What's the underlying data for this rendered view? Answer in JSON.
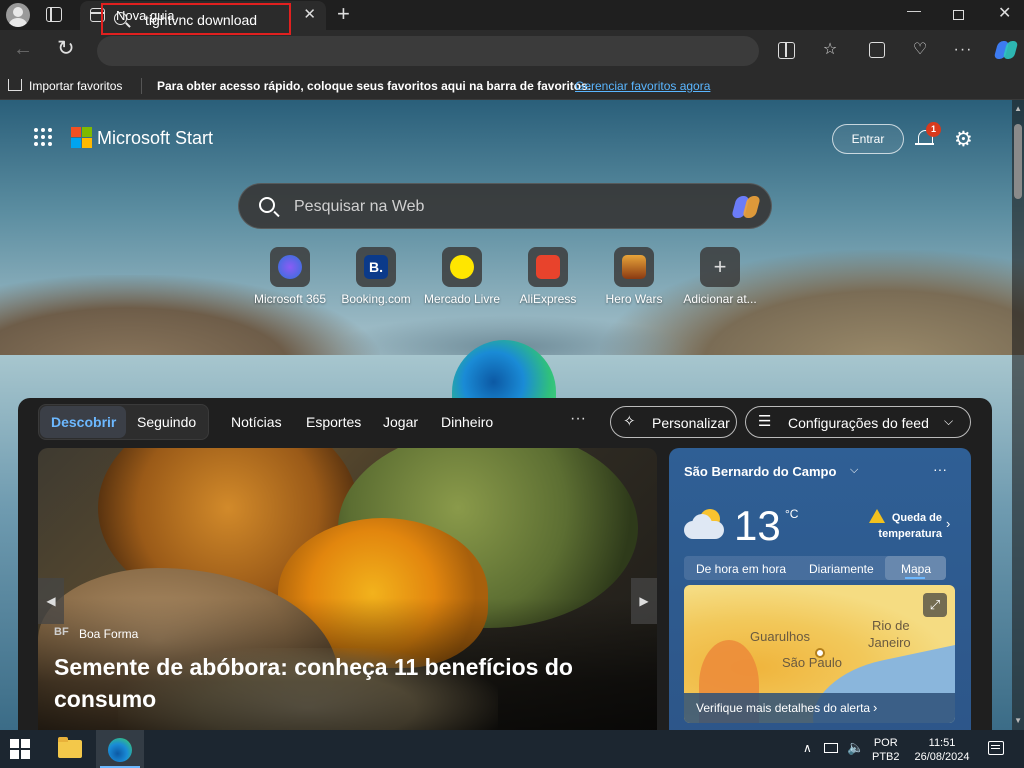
{
  "browser": {
    "tab_title": "Nova guia",
    "address_value": "tightvnc download",
    "icons": [
      "profile-icon",
      "tab-actions-icon",
      "back-icon",
      "refresh-icon",
      "split-screen-icon",
      "favorites-icon",
      "collections-icon",
      "browser-essentials-icon",
      "more-icon",
      "copilot-icon"
    ],
    "highlight_color": "#e0201f"
  },
  "favorites_bar": {
    "import_label": "Importar favoritos",
    "message": "Para obter acesso rápido, coloque seus favoritos aqui na barra de favoritos.",
    "manage_link": "Gerenciar favoritos agora"
  },
  "start_page": {
    "brand": "Microsoft Start",
    "signin_label": "Entrar",
    "notification_count": "1",
    "search_placeholder": "Pesquisar na Web",
    "quick_links": [
      {
        "label": "Microsoft 365",
        "glyph": "",
        "color": "#5a63d8"
      },
      {
        "label": "Booking.com",
        "glyph": "B.",
        "color": "#0b3a8a"
      },
      {
        "label": "Mercado Livre",
        "glyph": "",
        "color": "#ffe600"
      },
      {
        "label": "AliExpress",
        "glyph": "",
        "color": "#e8432c"
      },
      {
        "label": "Hero Wars",
        "glyph": "",
        "color": "#c26b1e"
      },
      {
        "label": "Adicionar at...",
        "glyph": "+",
        "color": "#4a4a4a"
      }
    ]
  },
  "feed": {
    "tabs": {
      "discover": "Descobrir",
      "following": "Seguindo",
      "news": "Notícias",
      "sports": "Esportes",
      "play": "Jogar",
      "money": "Dinheiro"
    },
    "more": "···",
    "personalize_label": "Personalizar",
    "feed_settings_label": "Configurações do feed",
    "hero": {
      "source_logo": "BF",
      "source": "Boa Forma",
      "title": "Semente de abóbora: conheça 11 benefícios do consumo"
    }
  },
  "weather": {
    "city": "São Bernardo do Campo",
    "temperature": "13",
    "unit": "°C",
    "alert": "Queda de temperatura",
    "tabs": {
      "hourly": "De hora em hora",
      "daily": "Diariamente",
      "map": "Mapa"
    },
    "map_labels": {
      "city1": "Guarulhos",
      "city2": "Rio de",
      "city3": "Janeiro",
      "city4": "São Paulo"
    },
    "map_footer": "Verifique mais detalhes do alerta"
  },
  "taskbar": {
    "language_line1": "POR",
    "language_line2": "PTB2",
    "time": "11:51",
    "date": "26/08/2024"
  }
}
